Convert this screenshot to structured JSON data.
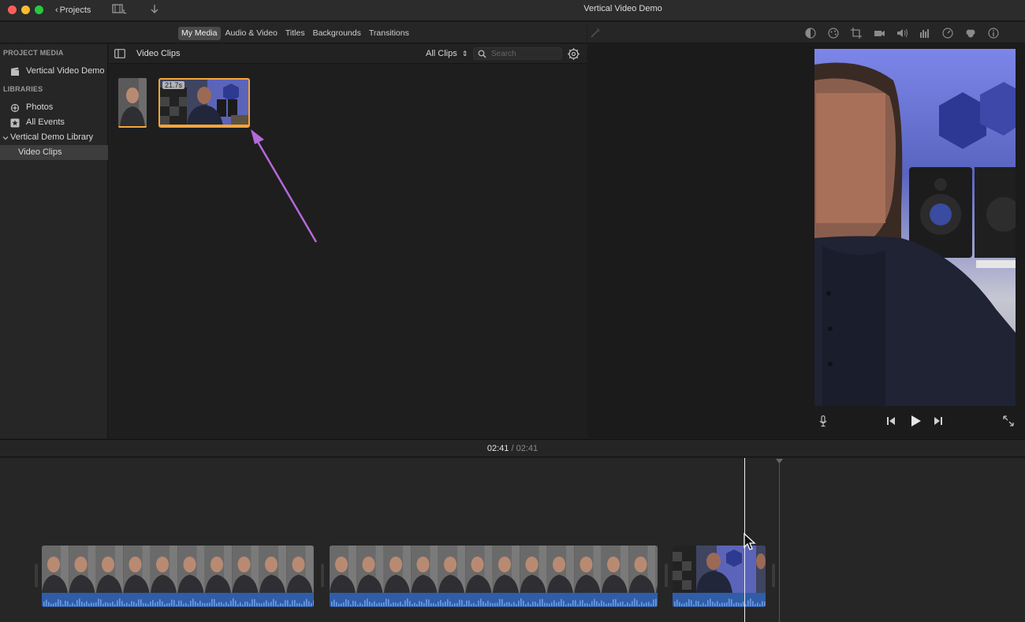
{
  "window": {
    "title": "Vertical Video Demo"
  },
  "toolbar": {
    "projects_label": "Projects"
  },
  "tabs": [
    {
      "label": "My Media",
      "active": true
    },
    {
      "label": "Audio & Video",
      "active": false
    },
    {
      "label": "Titles",
      "active": false
    },
    {
      "label": "Backgrounds",
      "active": false
    },
    {
      "label": "Transitions",
      "active": false
    }
  ],
  "sidebar": {
    "project_media_header": "PROJECT MEDIA",
    "project_item": "Vertical Video Demo",
    "libraries_header": "LIBRARIES",
    "items": [
      {
        "label": "Photos",
        "icon": "flower-icon"
      },
      {
        "label": "All Events",
        "icon": "star-icon"
      },
      {
        "label": "Vertical Demo Library",
        "icon": "chevron-down-icon"
      },
      {
        "label": "Video Clips",
        "icon": "",
        "selected": true
      }
    ]
  },
  "browser": {
    "title": "Video Clips",
    "filter": "All Clips",
    "search_placeholder": "Search",
    "clips": [
      {
        "duration": ""
      },
      {
        "duration": "21.7s"
      }
    ]
  },
  "timeline": {
    "current_time": "02:41",
    "separator": "/",
    "total_time": "02:41"
  },
  "colors": {
    "accent_orange": "#f3a53b",
    "audio_blue": "#2f5da8",
    "annotation_arrow": "#b469d8",
    "face_blur": "#a87059"
  }
}
